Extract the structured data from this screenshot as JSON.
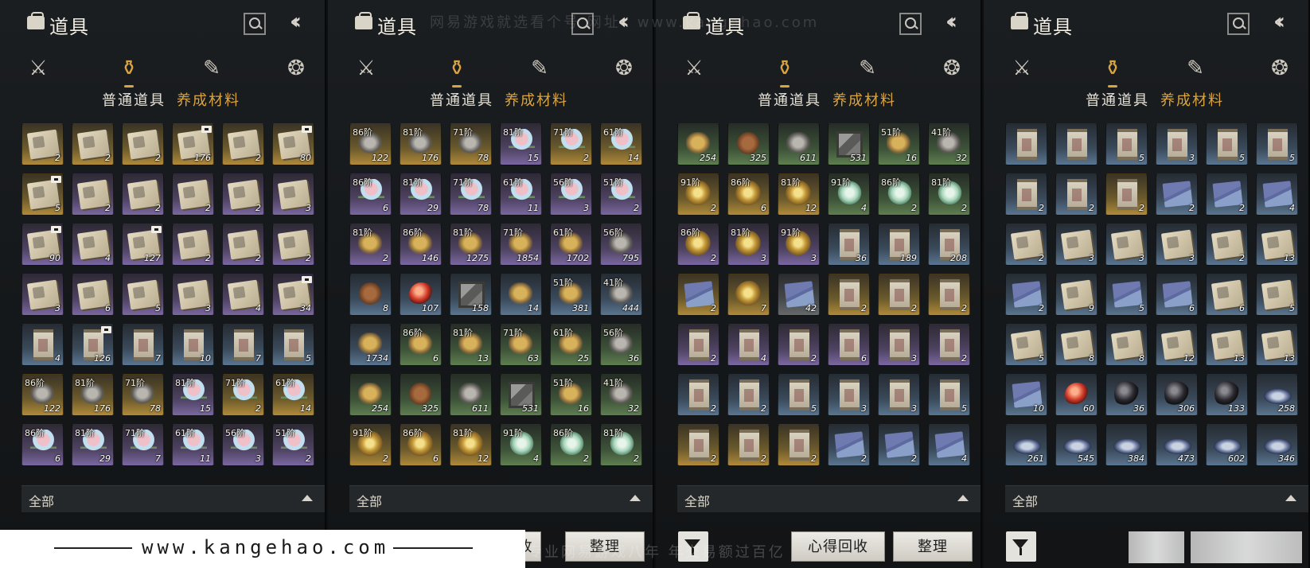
{
  "panel_common": {
    "title": "道具",
    "subtab_normal": "普通道具",
    "subtab_material": "养成材料",
    "filter_label": "全部",
    "recycle_label": "心得回收",
    "sort_label": "整理",
    "icons": {
      "bag": "bag-icon",
      "search": "search-icon",
      "back": "back-chevrons-icon",
      "cat_weapon": "crossed-swords-icon",
      "cat_material": "pouch-icon",
      "cat_scroll": "scroll-icon",
      "cat_misc": "token-icon",
      "filter": "filter-icon"
    }
  },
  "watermarks": {
    "top": "网易游戏就选看个号  网址：www.kangehao.com",
    "bottom_overlay": "看个号专业网易游戏八年  年交易额过百亿",
    "banner": "www.kangehao.com"
  },
  "colors": {
    "accent_gold": "#d9a441",
    "rarity_gold": "#b08a3a",
    "rarity_purple": "#7a67a0",
    "rarity_blue": "#5a7590",
    "rarity_green": "#5e7e50",
    "rarity_gray": "#66696c"
  },
  "panels": [
    {
      "bottom": {
        "show_filter_icon": false,
        "show_recycle_full": false,
        "recycle_partial": "收",
        "sort_label": "整理"
      },
      "items": [
        {
          "r": "gold",
          "i": "book",
          "q": "2"
        },
        {
          "r": "gold",
          "i": "book",
          "q": "2"
        },
        {
          "r": "gold",
          "i": "book",
          "q": "2"
        },
        {
          "r": "gold",
          "i": "book",
          "q": "176",
          "b": true
        },
        {
          "r": "gold",
          "i": "book",
          "q": "2"
        },
        {
          "r": "gold",
          "i": "book",
          "q": "80",
          "b": true
        },
        {
          "r": "gold",
          "i": "book",
          "q": "5",
          "b": true
        },
        {
          "r": "purple",
          "i": "book",
          "q": "2"
        },
        {
          "r": "purple",
          "i": "book",
          "q": "2"
        },
        {
          "r": "purple",
          "i": "book",
          "q": "2"
        },
        {
          "r": "purple",
          "i": "book",
          "q": "2"
        },
        {
          "r": "purple",
          "i": "book",
          "q": "3"
        },
        {
          "r": "purple",
          "i": "book",
          "q": "90",
          "b": true
        },
        {
          "r": "purple",
          "i": "book",
          "q": "4"
        },
        {
          "r": "purple",
          "i": "book",
          "q": "127",
          "b": true
        },
        {
          "r": "purple",
          "i": "book",
          "q": "2"
        },
        {
          "r": "purple",
          "i": "book",
          "q": "2"
        },
        {
          "r": "purple",
          "i": "book",
          "q": "2"
        },
        {
          "r": "purple",
          "i": "book",
          "q": "3"
        },
        {
          "r": "purple",
          "i": "book",
          "q": "6"
        },
        {
          "r": "purple",
          "i": "book",
          "q": "5"
        },
        {
          "r": "purple",
          "i": "book",
          "q": "3"
        },
        {
          "r": "purple",
          "i": "book",
          "q": "4"
        },
        {
          "r": "purple",
          "i": "book",
          "q": "34",
          "b": true
        },
        {
          "r": "blue",
          "i": "scroll",
          "q": "4"
        },
        {
          "r": "blue",
          "i": "scroll",
          "q": "126",
          "b": true
        },
        {
          "r": "blue",
          "i": "scroll",
          "q": "7"
        },
        {
          "r": "blue",
          "i": "scroll",
          "q": "10"
        },
        {
          "r": "blue",
          "i": "scroll",
          "q": "7"
        },
        {
          "r": "blue",
          "i": "scroll",
          "q": "5"
        },
        {
          "r": "gold",
          "i": "stone",
          "t": "86阶",
          "q": "122"
        },
        {
          "r": "gold",
          "i": "stone",
          "t": "81阶",
          "q": "176"
        },
        {
          "r": "gold",
          "i": "stone",
          "t": "71阶",
          "q": "78"
        },
        {
          "r": "purple",
          "i": "flower",
          "t": "81阶",
          "q": "15"
        },
        {
          "r": "gold",
          "i": "flower",
          "t": "71阶",
          "q": "2"
        },
        {
          "r": "gold",
          "i": "flower",
          "t": "61阶",
          "q": "14"
        },
        {
          "r": "purple",
          "i": "flower",
          "t": "86阶",
          "q": "6"
        },
        {
          "r": "purple",
          "i": "flower",
          "t": "81阶",
          "q": "29"
        },
        {
          "r": "purple",
          "i": "flower",
          "t": "71阶",
          "q": "7"
        },
        {
          "r": "purple",
          "i": "flower",
          "t": "61阶",
          "q": "11"
        },
        {
          "r": "purple",
          "i": "flower",
          "t": "56阶",
          "q": "3"
        },
        {
          "r": "purple",
          "i": "flower",
          "t": "51阶",
          "q": "2"
        }
      ]
    },
    {
      "bottom": {
        "show_filter_icon": false,
        "show_recycle_full": false,
        "recycle_partial": "收",
        "sort_label": "整理"
      },
      "items": [
        {
          "r": "gold",
          "i": "stone",
          "t": "86阶",
          "q": "122"
        },
        {
          "r": "gold",
          "i": "stone",
          "t": "81阶",
          "q": "176"
        },
        {
          "r": "gold",
          "i": "stone",
          "t": "71阶",
          "q": "78"
        },
        {
          "r": "purple",
          "i": "flower",
          "t": "81阶",
          "q": "15"
        },
        {
          "r": "gold",
          "i": "flower",
          "t": "71阶",
          "q": "2"
        },
        {
          "r": "gold",
          "i": "flower",
          "t": "61阶",
          "q": "14"
        },
        {
          "r": "purple",
          "i": "flower",
          "t": "86阶",
          "q": "6"
        },
        {
          "r": "purple",
          "i": "flower",
          "t": "81阶",
          "q": "29"
        },
        {
          "r": "purple",
          "i": "flower",
          "t": "71阶",
          "q": "78"
        },
        {
          "r": "purple",
          "i": "flower",
          "t": "61阶",
          "q": "11"
        },
        {
          "r": "purple",
          "i": "flower",
          "t": "56阶",
          "q": "3"
        },
        {
          "r": "purple",
          "i": "flower",
          "t": "51阶",
          "q": "2"
        },
        {
          "r": "purple",
          "i": "ore",
          "t": "81阶",
          "q": "2"
        },
        {
          "r": "purple",
          "i": "ore",
          "t": "86阶",
          "q": "146"
        },
        {
          "r": "purple",
          "i": "ore",
          "t": "81阶",
          "q": "1275"
        },
        {
          "r": "purple",
          "i": "ore",
          "t": "71阶",
          "q": "1854"
        },
        {
          "r": "purple",
          "i": "ore",
          "t": "61阶",
          "q": "1702"
        },
        {
          "r": "purple",
          "i": "stone",
          "t": "56阶",
          "q": "795"
        },
        {
          "r": "blue",
          "i": "pouch",
          "q": "8"
        },
        {
          "r": "blue",
          "i": "pill",
          "q": "107"
        },
        {
          "r": "blue",
          "i": "crate",
          "q": "158"
        },
        {
          "r": "blue",
          "i": "ore",
          "q": "14"
        },
        {
          "r": "blue",
          "i": "ore",
          "t": "51阶",
          "q": "381"
        },
        {
          "r": "blue",
          "i": "stone",
          "t": "41阶",
          "q": "444"
        },
        {
          "r": "blue",
          "i": "ore",
          "q": "1734"
        },
        {
          "r": "green",
          "i": "ore",
          "t": "86阶",
          "q": "6"
        },
        {
          "r": "green",
          "i": "ore",
          "t": "81阶",
          "q": "13"
        },
        {
          "r": "green",
          "i": "ore",
          "t": "71阶",
          "q": "63"
        },
        {
          "r": "green",
          "i": "ore",
          "t": "61阶",
          "q": "25"
        },
        {
          "r": "green",
          "i": "stone",
          "t": "56阶",
          "q": "36"
        },
        {
          "r": "green",
          "i": "ore",
          "q": "254"
        },
        {
          "r": "green",
          "i": "pouch",
          "q": "325"
        },
        {
          "r": "green",
          "i": "stone",
          "q": "611"
        },
        {
          "r": "green",
          "i": "crate",
          "q": "531"
        },
        {
          "r": "green",
          "i": "ore",
          "t": "51阶",
          "q": "16"
        },
        {
          "r": "green",
          "i": "stone",
          "t": "41阶",
          "q": "32"
        },
        {
          "r": "gold",
          "i": "shell",
          "t": "91阶",
          "q": "2"
        },
        {
          "r": "gold",
          "i": "shell",
          "t": "86阶",
          "q": "6"
        },
        {
          "r": "gold",
          "i": "shell",
          "t": "81阶",
          "q": "12"
        },
        {
          "r": "green",
          "i": "jade",
          "t": "91阶",
          "q": "4"
        },
        {
          "r": "green",
          "i": "jade",
          "t": "86阶",
          "q": "2"
        },
        {
          "r": "green",
          "i": "jade",
          "t": "81阶",
          "q": "2"
        }
      ]
    },
    {
      "bottom": {
        "show_filter_icon": true,
        "show_recycle_full": true,
        "recycle_partial": "",
        "sort_label": "整理"
      },
      "items": [
        {
          "r": "green",
          "i": "ore",
          "q": "254"
        },
        {
          "r": "green",
          "i": "pouch",
          "q": "325"
        },
        {
          "r": "green",
          "i": "stone",
          "q": "611"
        },
        {
          "r": "green",
          "i": "crate",
          "q": "531"
        },
        {
          "r": "green",
          "i": "ore",
          "t": "51阶",
          "q": "16"
        },
        {
          "r": "green",
          "i": "stone",
          "t": "41阶",
          "q": "32"
        },
        {
          "r": "gold",
          "i": "shell",
          "t": "91阶",
          "q": "2"
        },
        {
          "r": "gold",
          "i": "shell",
          "t": "86阶",
          "q": "6"
        },
        {
          "r": "gold",
          "i": "shell",
          "t": "81阶",
          "q": "12"
        },
        {
          "r": "green",
          "i": "jade",
          "t": "91阶",
          "q": "4"
        },
        {
          "r": "green",
          "i": "jade",
          "t": "86阶",
          "q": "2"
        },
        {
          "r": "green",
          "i": "jade",
          "t": "81阶",
          "q": "2"
        },
        {
          "r": "purple",
          "i": "shell",
          "t": "86阶",
          "q": "2"
        },
        {
          "r": "purple",
          "i": "shell",
          "t": "81阶",
          "q": "3"
        },
        {
          "r": "purple",
          "i": "shell",
          "t": "91阶",
          "q": "3"
        },
        {
          "r": "blue",
          "i": "scroll",
          "q": "36"
        },
        {
          "r": "blue",
          "i": "scroll",
          "q": "189"
        },
        {
          "r": "blue",
          "i": "scroll",
          "q": "208"
        },
        {
          "r": "gold",
          "i": "cloth",
          "q": "2"
        },
        {
          "r": "gold",
          "i": "shell",
          "q": "7"
        },
        {
          "r": "gray",
          "i": "cloth",
          "q": "42"
        },
        {
          "r": "gold",
          "i": "scroll",
          "q": "2"
        },
        {
          "r": "gold",
          "i": "scroll",
          "q": "2"
        },
        {
          "r": "gold",
          "i": "scroll",
          "q": "2"
        },
        {
          "r": "purple",
          "i": "scroll",
          "q": "2"
        },
        {
          "r": "purple",
          "i": "scroll",
          "q": "4"
        },
        {
          "r": "purple",
          "i": "scroll",
          "q": "2"
        },
        {
          "r": "purple",
          "i": "scroll",
          "q": "6"
        },
        {
          "r": "purple",
          "i": "scroll",
          "q": "3"
        },
        {
          "r": "purple",
          "i": "scroll",
          "q": "2"
        },
        {
          "r": "blue",
          "i": "scroll",
          "q": "2"
        },
        {
          "r": "blue",
          "i": "scroll",
          "q": "2"
        },
        {
          "r": "blue",
          "i": "scroll",
          "q": "5"
        },
        {
          "r": "blue",
          "i": "scroll",
          "q": "3"
        },
        {
          "r": "blue",
          "i": "scroll",
          "q": "3"
        },
        {
          "r": "blue",
          "i": "scroll",
          "q": "5"
        },
        {
          "r": "gold",
          "i": "scroll",
          "q": "2"
        },
        {
          "r": "gold",
          "i": "scroll",
          "q": "2"
        },
        {
          "r": "gold",
          "i": "scroll",
          "q": "2"
        },
        {
          "r": "blue",
          "i": "cloth",
          "q": "2"
        },
        {
          "r": "blue",
          "i": "cloth",
          "q": "2"
        },
        {
          "r": "blue",
          "i": "cloth",
          "q": "4"
        }
      ]
    },
    {
      "bottom": {
        "show_filter_icon": true,
        "show_recycle_full": false,
        "recycle_partial": "",
        "sort_label": ""
      },
      "items": [
        {
          "r": "blue",
          "i": "scroll",
          "q": ""
        },
        {
          "r": "blue",
          "i": "scroll",
          "q": ""
        },
        {
          "r": "blue",
          "i": "scroll",
          "q": "5"
        },
        {
          "r": "blue",
          "i": "scroll",
          "q": "3"
        },
        {
          "r": "blue",
          "i": "scroll",
          "q": "5"
        },
        {
          "r": "blue",
          "i": "scroll",
          "q": "5"
        },
        {
          "r": "blue",
          "i": "scroll",
          "q": "2"
        },
        {
          "r": "blue",
          "i": "scroll",
          "q": "2"
        },
        {
          "r": "gold",
          "i": "scroll",
          "q": "2"
        },
        {
          "r": "blue",
          "i": "cloth",
          "q": "2"
        },
        {
          "r": "blue",
          "i": "cloth",
          "q": "2"
        },
        {
          "r": "blue",
          "i": "cloth",
          "q": "4"
        },
        {
          "r": "blue",
          "i": "book",
          "q": "2"
        },
        {
          "r": "blue",
          "i": "book",
          "q": "3"
        },
        {
          "r": "blue",
          "i": "book",
          "q": "3"
        },
        {
          "r": "blue",
          "i": "book",
          "q": "3"
        },
        {
          "r": "blue",
          "i": "book",
          "q": "2"
        },
        {
          "r": "blue",
          "i": "book",
          "q": "13"
        },
        {
          "r": "blue",
          "i": "cloth",
          "q": "2"
        },
        {
          "r": "blue",
          "i": "book",
          "q": "9"
        },
        {
          "r": "blue",
          "i": "cloth",
          "q": "5"
        },
        {
          "r": "blue",
          "i": "cloth",
          "q": "6"
        },
        {
          "r": "blue",
          "i": "book",
          "q": "6"
        },
        {
          "r": "blue",
          "i": "book",
          "q": "5"
        },
        {
          "r": "blue",
          "i": "book",
          "q": "5"
        },
        {
          "r": "blue",
          "i": "book",
          "q": "8"
        },
        {
          "r": "blue",
          "i": "book",
          "q": "8"
        },
        {
          "r": "blue",
          "i": "book",
          "q": "12"
        },
        {
          "r": "blue",
          "i": "book",
          "q": "13"
        },
        {
          "r": "blue",
          "i": "book",
          "q": "13"
        },
        {
          "r": "blue",
          "i": "cloth",
          "q": "10"
        },
        {
          "r": "blue",
          "i": "pill",
          "q": "60"
        },
        {
          "r": "blue",
          "i": "obsid",
          "q": "36"
        },
        {
          "r": "blue",
          "i": "obsid",
          "q": "306"
        },
        {
          "r": "blue",
          "i": "obsid",
          "q": "133"
        },
        {
          "r": "blue",
          "i": "dish",
          "q": "258"
        },
        {
          "r": "blue",
          "i": "dish",
          "q": "261"
        },
        {
          "r": "blue",
          "i": "dish",
          "q": "545"
        },
        {
          "r": "blue",
          "i": "dish",
          "q": "384"
        },
        {
          "r": "blue",
          "i": "dish",
          "q": "473"
        },
        {
          "r": "blue",
          "i": "dish",
          "q": "602"
        },
        {
          "r": "blue",
          "i": "dish",
          "q": "346"
        }
      ]
    }
  ]
}
